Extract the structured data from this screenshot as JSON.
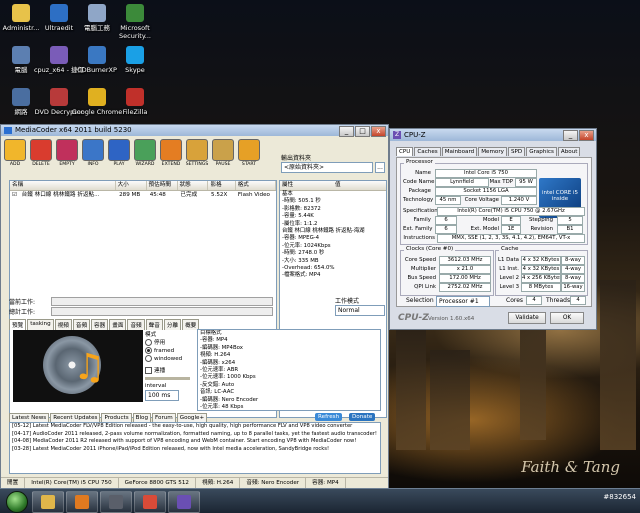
{
  "desktop": {
    "icons": [
      {
        "label": "Administr...",
        "color": "#e7c24a"
      },
      {
        "label": "Ultraedit",
        "color": "#2d6fc4"
      },
      {
        "label": "電腦工務",
        "color": "#8fa6c7"
      },
      {
        "label": "Microsoft Security...",
        "color": "#3c8a3a"
      },
      {
        "label": "電腦",
        "color": "#5c7fb1"
      },
      {
        "label": "cpuz_x64 - 捷徑",
        "color": "#7a5cb8"
      },
      {
        "label": "CDBurnerXP",
        "color": "#3a78c2"
      },
      {
        "label": "Skype",
        "color": "#1aa0e6"
      },
      {
        "label": "網路",
        "color": "#4a6ea0"
      },
      {
        "label": "DVD Decrypter",
        "color": "#b83a3a"
      },
      {
        "label": "Google Chrome",
        "color": "#e0b020"
      },
      {
        "label": "FileZilla",
        "color": "#c0302a"
      }
    ],
    "signature": "Faith & Tang",
    "watermark": "#832654"
  },
  "mediacoder": {
    "title": "MediaCoder x64 2011 build 5230",
    "window_controls": {
      "min": "_",
      "max": "□",
      "close": "x"
    },
    "toolbar": [
      {
        "label": "ADD",
        "color": "#f1b62b"
      },
      {
        "label": "DELETE",
        "color": "#d93c2e"
      },
      {
        "label": "EMPTY",
        "color": "#c0305c"
      },
      {
        "label": "INFO",
        "color": "#3b76c8"
      },
      {
        "label": "PLAY",
        "color": "#2e64c4"
      },
      {
        "label": "WIZARD",
        "color": "#4aa05a"
      },
      {
        "label": "EXTEND",
        "color": "#e47d22"
      },
      {
        "label": "SETTINGS",
        "color": "#d8a23a"
      },
      {
        "label": "PAUSE",
        "color": "#caa14a"
      },
      {
        "label": "START",
        "color": "#e6a026"
      }
    ],
    "output_folder": {
      "label": "輸出資料夾",
      "value": "<原始資料夾>",
      "browse": "..."
    },
    "file_list": {
      "headers": [
        "名稱",
        "大小",
        "預估時間",
        "狀態",
        "影格",
        "格式"
      ],
      "rows": [
        {
          "checked": "☑",
          "name": "台鐵 林口線 桃林鐵路 折返點...",
          "size": "289 MB",
          "duration": "45:48",
          "status": "已完成",
          "frames": "5.52X",
          "format": "Flash Video"
        }
      ]
    },
    "properties": {
      "headers": [
        "屬性",
        "值"
      ],
      "lines": [
        "基本",
        " -時間: 505.1 秒",
        " -影格數: 82372",
        " -容量: 5.44K",
        " -屬位率: 1:1.2",
        "台鐵 林口線 桃林鐵路 折返點-海湖",
        " -容器: MPEG-4",
        "   -位元率: 1024Kbps",
        "   -時間: 2748.0 秒",
        "   -大小: 335 MB",
        "   -Overhead: 654.0%",
        "   -檔案格式: MP4"
      ]
    },
    "progress": [
      {
        "label": "當前工作:",
        "value": 0
      },
      {
        "label": "總計工作:",
        "value": 0
      }
    ],
    "work_type": {
      "label": "工作模式",
      "value": "Normal"
    },
    "tabs": [
      "預覽",
      "tasking",
      "視頻",
      "音頻",
      "容器",
      "畫面",
      "音頻",
      "聲音",
      "分離",
      "概要"
    ],
    "preview_mode": {
      "title": "模式",
      "options": [
        {
          "label": "停用",
          "selected": false
        },
        {
          "label": "framed",
          "selected": true
        },
        {
          "label": "windowed",
          "selected": false
        }
      ],
      "update_label": "連播",
      "interval_label": "interval",
      "interval_value": "100 ms"
    },
    "settings_lines": [
      "目標格式",
      " -容器: MP4",
      "   -編碼器: MP4Box",
      "視頻: H.264",
      "   -編碼器: x264",
      "   -位元速率: ABR",
      "   -位元速率: 1000 Kbps",
      "   -反交錯: Auto",
      "音訊: LC-AAC",
      "   -編碼器: Nero Encoder",
      "   -位元率: 48 Kbps"
    ],
    "news": {
      "tabs": [
        "Latest News",
        "Recent Updates",
        "Products",
        "Blog",
        "Forum",
        "Google+"
      ],
      "refresh_label": "Refresh",
      "donate_label": "Donate",
      "items": [
        "[05-12] Latest MediaCoder FLV/VP8 Edition released - the easy-to-use, high quality, high performance FLV and VP8 video converter",
        "[04-17] AudioCoder 2011 released, 2-pass volume normalization, formatted naming, up to 8 parallel tasks, yet the fastest audio transcoder!",
        "[04-08] MediaCoder 2011 R2 released with support of VP8 encoding and WebM container. Start encoding VP8 with MediaCoder now!",
        "[03-28] Latest MediaCoder 2011 iPhone/iPad/iPod Edition released, now with Intel media acceleration, SandyBridge rocks!"
      ]
    },
    "status": [
      "閒置",
      "Intel(R) Core(TM) i5 CPU 750",
      "GeForce 8800 GTS 512",
      "視頻: H.264",
      "音頻: Nero Encoder",
      "容器: MP4"
    ]
  },
  "cpuz": {
    "title": "CPU-Z",
    "tabs": [
      "CPU",
      "Caches",
      "Mainboard",
      "Memory",
      "SPD",
      "Graphics",
      "About"
    ],
    "processor": {
      "group": "Processor",
      "name_label": "Name",
      "name": "Intel Core i5 750",
      "codename_label": "Code Name",
      "codename": "Lynnfield",
      "tdp_label": "Max TDP",
      "tdp": "95 W",
      "package_label": "Package",
      "package": "Socket 1156 LGA",
      "tech_label": "Technology",
      "tech": "45 nm",
      "voltage_label": "Core Voltage",
      "voltage": "1.240 V",
      "spec_label": "Specification",
      "spec": "Intel(R) Core(TM) i5 CPU 750 @ 2.67GHz",
      "family_label": "Family",
      "family": "6",
      "model_label": "Model",
      "model": "E",
      "stepping_label": "Stepping",
      "stepping": "5",
      "extfamily_label": "Ext. Family",
      "extfamily": "6",
      "extmodel_label": "Ext. Model",
      "extmodel": "1E",
      "revision_label": "Revision",
      "revision": "B1",
      "instr_label": "Instructions",
      "instr": "MMX, SSE (1, 2, 3, 3S, 4.1, 4.2), EM64T, VT-x",
      "logo": "intel CORE i5 inside"
    },
    "clocks": {
      "group": "Clocks (Core #0)",
      "core_speed_label": "Core Speed",
      "core_speed": "3612.03 MHz",
      "multiplier_label": "Multiplier",
      "multiplier": "x 21.0",
      "bus_label": "Bus Speed",
      "bus": "172.00 MHz",
      "qpi_label": "QPI Link",
      "qpi": "2752.02 MHz"
    },
    "cache": {
      "group": "Cache",
      "rows": [
        {
          "label": "L1 Data",
          "size": "4 x 32 KBytes",
          "way": "8-way"
        },
        {
          "label": "L1 Inst.",
          "size": "4 x 32 KBytes",
          "way": "4-way"
        },
        {
          "label": "Level 2",
          "size": "4 x 256 KBytes",
          "way": "8-way"
        },
        {
          "label": "Level 3",
          "size": "8 MBytes",
          "way": "16-way"
        }
      ]
    },
    "selection_label": "Selection",
    "selection": "Processor #1",
    "cores_label": "Cores",
    "cores": "4",
    "threads_label": "Threads",
    "threads": "4",
    "footer_brand": "CPU-Z",
    "version": "Version 1.60.x64",
    "validate_label": "Validate",
    "ok_label": "OK"
  },
  "taskbar": {
    "buttons": [
      {
        "name": "windows-explorer",
        "color": "#e0b64a"
      },
      {
        "name": "media-player",
        "color": "#e07a20"
      },
      {
        "name": "mediacoder",
        "color": "#5a5f6a"
      },
      {
        "name": "chrome",
        "color": "#d94b38"
      },
      {
        "name": "cpuz",
        "color": "#6a4fb3"
      }
    ]
  }
}
